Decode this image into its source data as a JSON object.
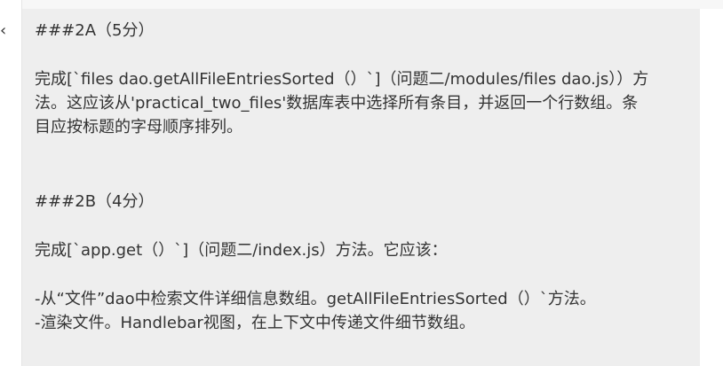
{
  "gutter": {
    "mark": "‹"
  },
  "section_2a": {
    "heading": "###2A（5分）",
    "paragraph_lines": [
      "完成[`files dao.getAllFileEntriesSorted（）`]（问题二/modules/files dao.js））方",
      "法。这应该从'practical_two_files'数据库表中选择所有条目，并返回一个行数组。条",
      "目应按标题的字母顺序排列。"
    ]
  },
  "section_2b": {
    "heading": "###2B（4分）",
    "intro": "完成[`app.get（）`]（问题二/index.js）方法。它应该：",
    "bullets": [
      "-从“文件”dao中检索文件详细信息数组。getAllFileEntriesSorted（）`方法。",
      "-渲染文件。Handlebar视图，在上下文中传递文件细节数组。"
    ]
  }
}
